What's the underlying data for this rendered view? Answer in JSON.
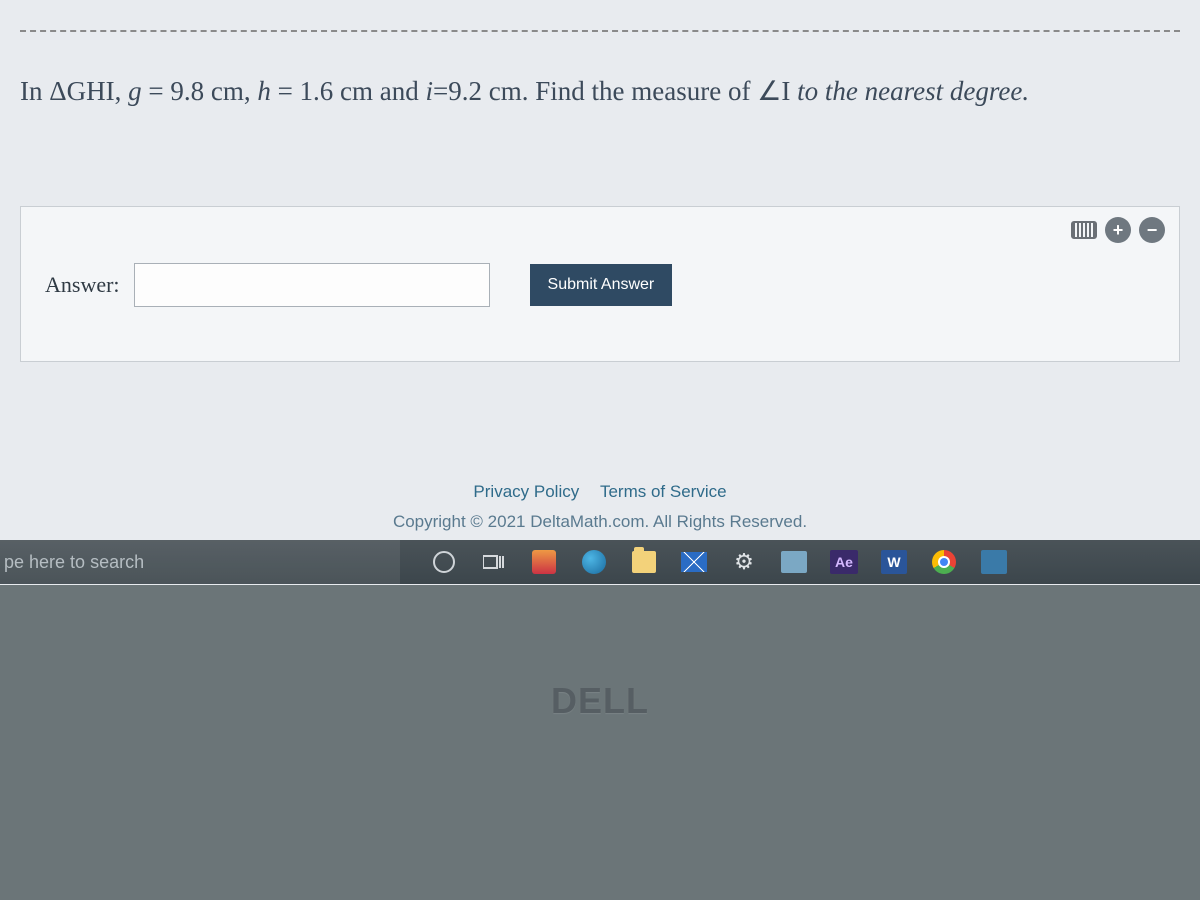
{
  "question": {
    "prefix": "In ",
    "triangle": "ΔGHI, ",
    "part1_plain": "",
    "var_g": "g",
    "eq_g": " = 9.8 cm, ",
    "var_h": "h",
    "eq_h": " = 1.6 cm and ",
    "var_i": "i",
    "eq_i": "=9.2 cm. Find the measure of ",
    "angle": "∠I",
    "tail_italic": " to the nearest degree."
  },
  "answer_section": {
    "label": "Answer:",
    "input_value": "",
    "submit_label": "Submit Answer"
  },
  "footer": {
    "privacy": "Privacy Policy",
    "terms": "Terms of Service",
    "copyright": "Copyright © 2021 DeltaMath.com. All Rights Reserved."
  },
  "taskbar": {
    "search_placeholder": "pe here to search",
    "ae_label": "Ae",
    "word_label": "W"
  },
  "device": {
    "brand": "DELL"
  }
}
